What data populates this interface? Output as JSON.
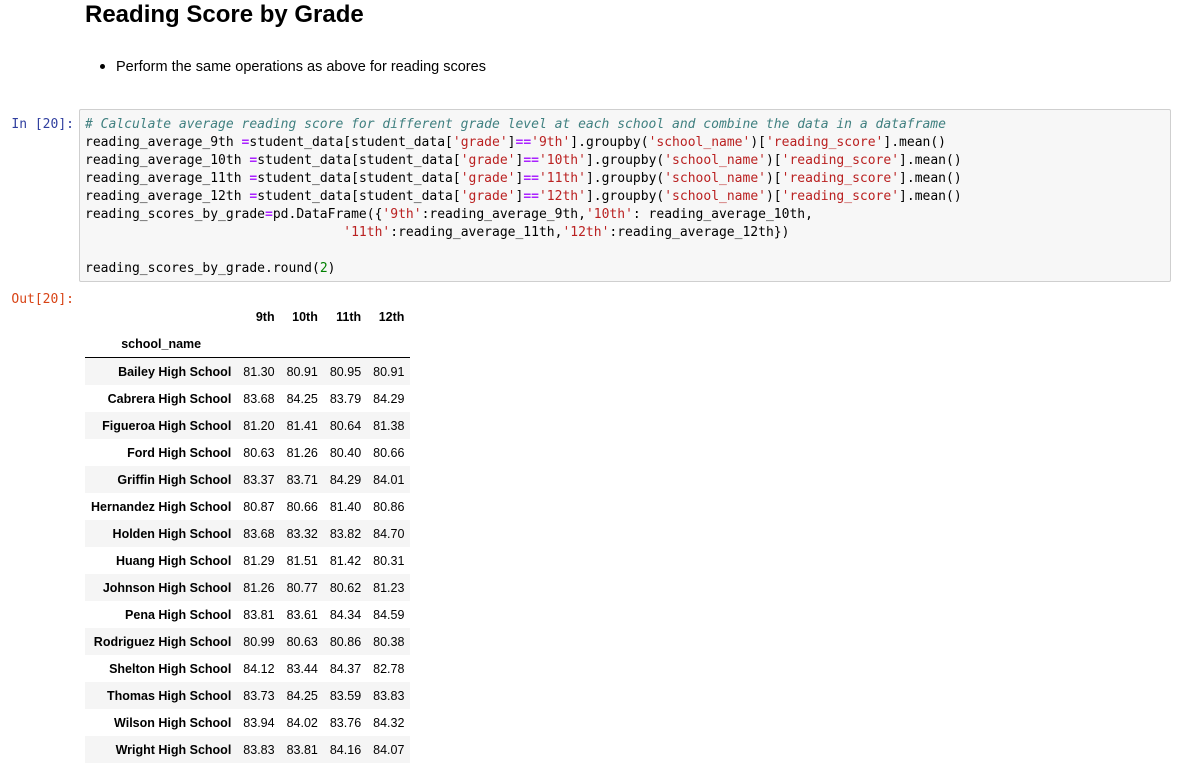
{
  "markdown": {
    "heading": "Reading Score by Grade",
    "bullet": "Perform the same operations as above for reading scores"
  },
  "cell": {
    "in_prompt": "In [20]:",
    "out_prompt": "Out[20]:"
  },
  "code_lines": [
    "# Calculate average reading score for different grade level at each school and combine the data in a dataframe",
    "reading_average_9th =student_data[student_data['grade']=='9th'].groupby('school_name')['reading_score'].mean()",
    "reading_average_10th =student_data[student_data['grade']=='10th'].groupby('school_name')['reading_score'].mean()",
    "reading_average_11th =student_data[student_data['grade']=='11th'].groupby('school_name')['reading_score'].mean()",
    "reading_average_12th =student_data[student_data['grade']=='12th'].groupby('school_name')['reading_score'].mean()",
    "reading_scores_by_grade=pd.DataFrame({'9th':reading_average_9th,'10th': reading_average_10th,",
    "                                 '11th':reading_average_11th,'12th':reading_average_12th})",
    "",
    "reading_scores_by_grade.round(2)"
  ],
  "table": {
    "index_name": "school_name",
    "columns": [
      "9th",
      "10th",
      "11th",
      "12th"
    ],
    "rows": [
      {
        "school": "Bailey High School",
        "values": [
          "81.30",
          "80.91",
          "80.95",
          "80.91"
        ]
      },
      {
        "school": "Cabrera High School",
        "values": [
          "83.68",
          "84.25",
          "83.79",
          "84.29"
        ]
      },
      {
        "school": "Figueroa High School",
        "values": [
          "81.20",
          "81.41",
          "80.64",
          "81.38"
        ]
      },
      {
        "school": "Ford High School",
        "values": [
          "80.63",
          "81.26",
          "80.40",
          "80.66"
        ]
      },
      {
        "school": "Griffin High School",
        "values": [
          "83.37",
          "83.71",
          "84.29",
          "84.01"
        ]
      },
      {
        "school": "Hernandez High School",
        "values": [
          "80.87",
          "80.66",
          "81.40",
          "80.86"
        ]
      },
      {
        "school": "Holden High School",
        "values": [
          "83.68",
          "83.32",
          "83.82",
          "84.70"
        ]
      },
      {
        "school": "Huang High School",
        "values": [
          "81.29",
          "81.51",
          "81.42",
          "80.31"
        ]
      },
      {
        "school": "Johnson High School",
        "values": [
          "81.26",
          "80.77",
          "80.62",
          "81.23"
        ]
      },
      {
        "school": "Pena High School",
        "values": [
          "83.81",
          "83.61",
          "84.34",
          "84.59"
        ]
      },
      {
        "school": "Rodriguez High School",
        "values": [
          "80.99",
          "80.63",
          "80.86",
          "80.38"
        ]
      },
      {
        "school": "Shelton High School",
        "values": [
          "84.12",
          "83.44",
          "84.37",
          "82.78"
        ]
      },
      {
        "school": "Thomas High School",
        "values": [
          "83.73",
          "84.25",
          "83.59",
          "83.83"
        ]
      },
      {
        "school": "Wilson High School",
        "values": [
          "83.94",
          "84.02",
          "83.76",
          "84.32"
        ]
      },
      {
        "school": "Wright High School",
        "values": [
          "83.83",
          "83.81",
          "84.16",
          "84.07"
        ]
      }
    ]
  }
}
